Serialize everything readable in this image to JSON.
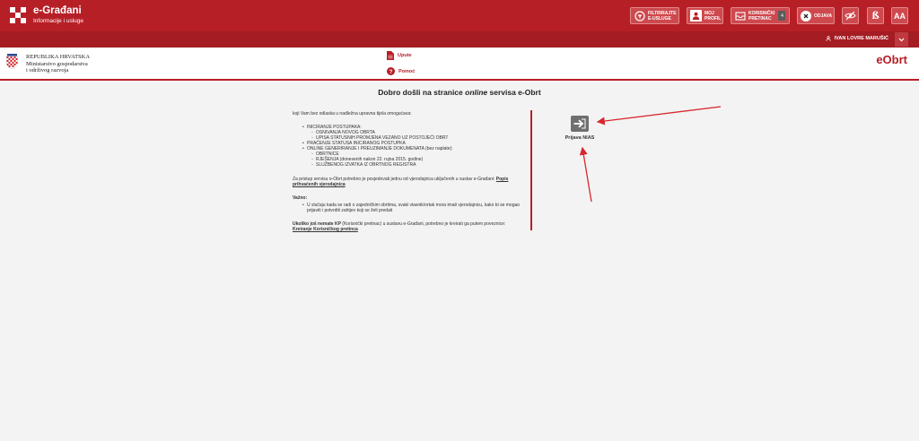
{
  "brand": {
    "title": "e-Građani",
    "subtitle": "Informacije i usluge"
  },
  "topbar": {
    "filter": {
      "label1": "FILTRIRAJTE",
      "label2": "E-USLUGE",
      "icon": "filter-icon"
    },
    "profile": {
      "label1": "MOJ",
      "label2": "PROFIL",
      "icon": "profile-icon"
    },
    "inbox": {
      "label1": "KORISNIČKI",
      "label2": "PRETINAC",
      "count": "4",
      "icon": "inbox-icon"
    },
    "logout": {
      "label": "ODJAVA",
      "icon": "close-icon"
    },
    "visibility": {
      "icon": "eye-slash-icon"
    },
    "dyslexia": {
      "label": "ß"
    },
    "font_size": {
      "label": "AA"
    }
  },
  "user": {
    "name": "IVAN LOVRE MARUŠIĆ"
  },
  "header": {
    "ministry_line1": "REPUBLIKA HRVATSKA",
    "ministry_line2": "Ministarstvo gospodarstva",
    "ministry_line3": "i održivog razvoja",
    "link_instructions": "Upute",
    "link_help": "Pomoć",
    "app_name": "eObrt"
  },
  "main": {
    "welcome_pre": "Dobro došli na stranice ",
    "welcome_em": "online",
    "welcome_post": " servisa e-Obrt",
    "intro": "koji Vam bez odlaska u nadležna upravna tijela omogućava:",
    "list1": [
      "INICIRANJE POSTUPAKA:",
      "PRAĆENJE STATUSA INICIRANOG POSTUPKA",
      "ONLINE GENERIRANJE I PREUZIMANJE DOKUMENATA (bez naplate):"
    ],
    "list1_sub1": [
      "OSNIVANJA NOVOG OBRTA",
      "UPISA STATUSNIH PROMJENA VEZANO UZ POSTOJEĆI OBRT"
    ],
    "list1_sub2": [
      "OBRTNICE",
      "RJEŠENJA (donesenih nakon 22. rujna 2015. godine)",
      "SLUŽBENOG IZVATKA IZ OBRTNOG REGISTRA"
    ],
    "access_text": "Za pristup servisu e-Obrt potrebno je posjedovati jednu od vjerodajnica uključenih u sustav e-Građani:",
    "access_link": "Popis prihvaćenih vjerodajnica",
    "important_title": "Važno:",
    "important_item": "U slučaju kada se radi o zajedničkim obrtima, svaki vlasnik/ortak mora imati vjerodajnicu, kako bi se mogao prijaviti i potvrditi zahtjev koji se želi predati",
    "kp_bold": "Ukoliko još nemate KP",
    "kp_text": " (Korisnički pretinac) u sustavu e-Građani, potrebno je kreirati ga putem poveznice: ",
    "kp_link": "Kreiranje Korisničkog pretinca",
    "login_label": "Prijava NIAS"
  },
  "colors": {
    "primary": "#b71f27",
    "secondary": "#a51c23",
    "button": "#ce494e",
    "login_button": "#6f6f6f"
  }
}
